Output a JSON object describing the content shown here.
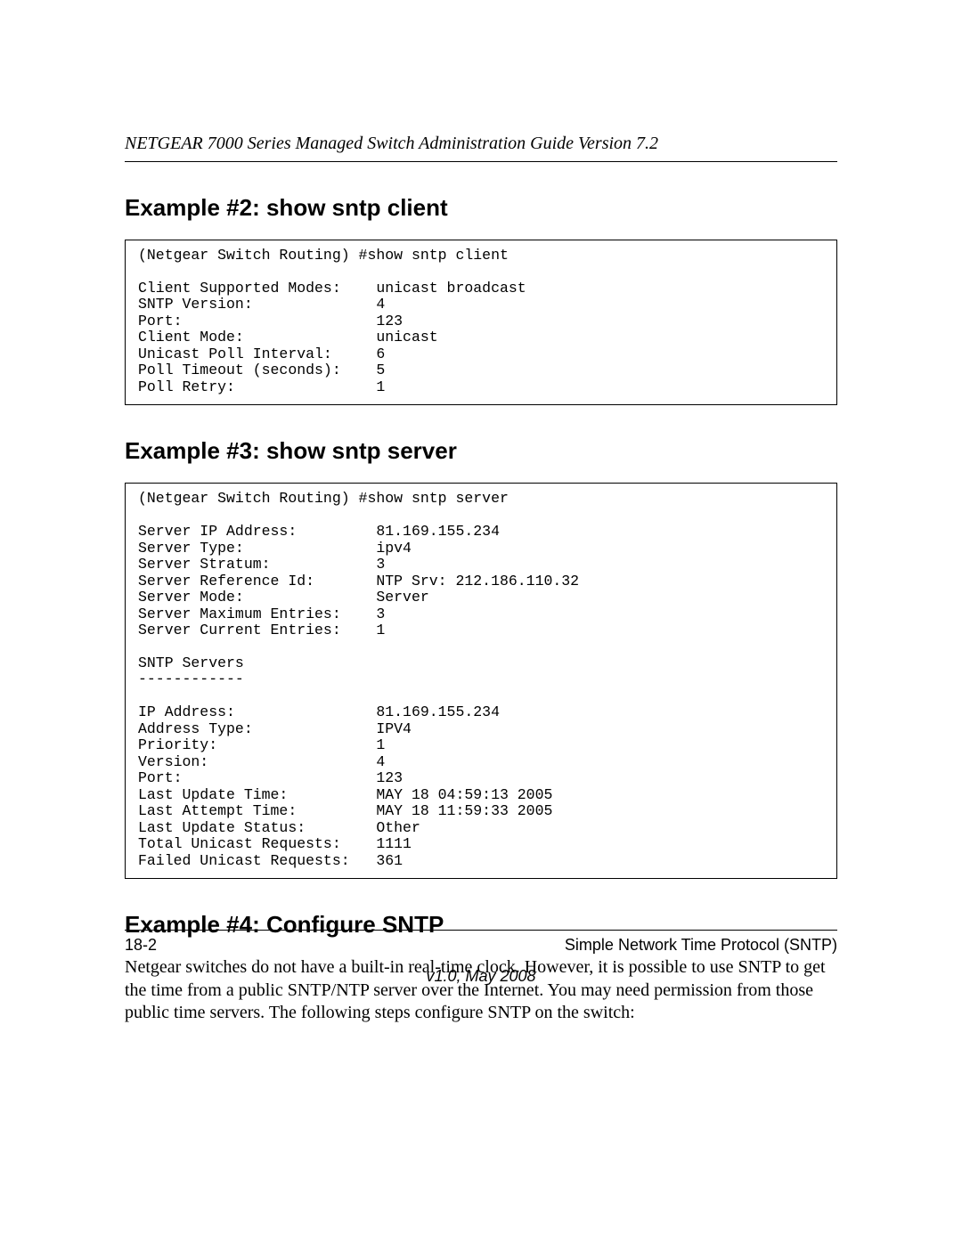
{
  "header": {
    "running": "NETGEAR 7000 Series Managed Switch Administration Guide Version 7.2"
  },
  "sections": {
    "ex2": {
      "title": "Example #2: show sntp client",
      "code": "(Netgear Switch Routing) #show sntp client\n\nClient Supported Modes:    unicast broadcast\nSNTP Version:              4\nPort:                      123\nClient Mode:               unicast\nUnicast Poll Interval:     6\nPoll Timeout (seconds):    5\nPoll Retry:                1"
    },
    "ex3": {
      "title": "Example #3: show sntp server",
      "code": "(Netgear Switch Routing) #show sntp server\n\nServer IP Address:         81.169.155.234\nServer Type:               ipv4\nServer Stratum:            3\nServer Reference Id:       NTP Srv: 212.186.110.32\nServer Mode:               Server\nServer Maximum Entries:    3\nServer Current Entries:    1\n\nSNTP Servers\n------------\n\nIP Address:                81.169.155.234\nAddress Type:              IPV4\nPriority:                  1\nVersion:                   4\nPort:                      123\nLast Update Time:          MAY 18 04:59:13 2005\nLast Attempt Time:         MAY 18 11:59:33 2005\nLast Update Status:        Other\nTotal Unicast Requests:    1111\nFailed Unicast Requests:   361"
    },
    "ex4": {
      "title": "Example #4: Configure SNTP",
      "body": "Netgear switches do not have a built-in real-time clock. However, it is possible to use SNTP to get the time from a public SNTP/NTP server over the Internet. You may need permission from those public time servers. The following steps configure SNTP on the switch:"
    }
  },
  "footer": {
    "page_number": "18-2",
    "chapter": "Simple Network Time Protocol (SNTP)",
    "version": "v1.0, May 2008"
  }
}
